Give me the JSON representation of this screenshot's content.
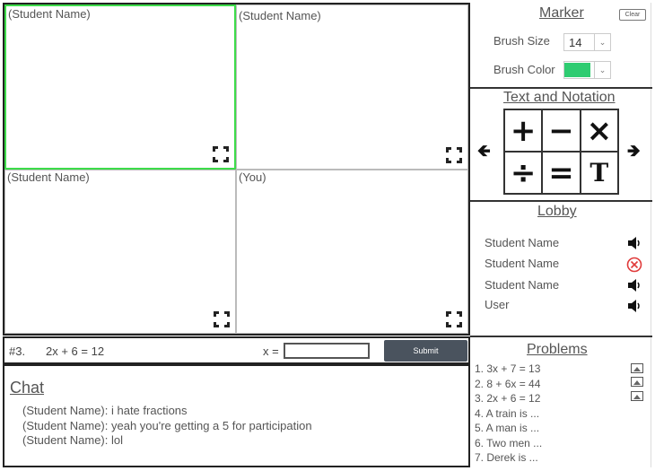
{
  "video_grid": {
    "cells": [
      {
        "label": "(Student Name)"
      },
      {
        "label": "(Student Name)"
      },
      {
        "label": "(Student Name)"
      },
      {
        "label": "(You)"
      }
    ]
  },
  "problem_bar": {
    "number": "#3.",
    "equation": "2x + 6 = 12",
    "x_label": "x =",
    "x_value": "",
    "submit_label": "Submit"
  },
  "chat": {
    "title": "Chat",
    "messages": [
      "(Student Name): i hate fractions",
      "(Student Name): yeah you're getting a 5 for participation",
      "(Student Name): lol"
    ]
  },
  "marker": {
    "title": "Marker",
    "clear_label": "Clear",
    "brush_size_label": "Brush Size",
    "brush_size_value": "14",
    "brush_color_label": "Brush Color",
    "brush_color": "#2ecc71"
  },
  "notation": {
    "title": "Text and Notation",
    "buttons": [
      "+",
      "−",
      "×",
      "÷",
      "=",
      "T"
    ]
  },
  "lobby": {
    "title": "Lobby",
    "members": [
      {
        "name": "Student Name",
        "status": "speaker-icon"
      },
      {
        "name": "Student Name",
        "status": "muted-x-icon"
      },
      {
        "name": "Student Name",
        "status": "speaker-icon"
      },
      {
        "name": "User",
        "status": "speaker-icon"
      }
    ]
  },
  "problems": {
    "title": "Problems",
    "items": [
      "1. 3x + 7 = 13",
      "2. 8 + 6x = 44",
      "3. 2x + 6 = 12",
      "4. A train is ...",
      "5. A man is  ...",
      "6. Two men ...",
      "7. Derek is ..."
    ]
  },
  "colors": {
    "active_border": "#3ddc4a",
    "submit_bg": "#4a535e",
    "muted_red": "#e03a3a"
  }
}
